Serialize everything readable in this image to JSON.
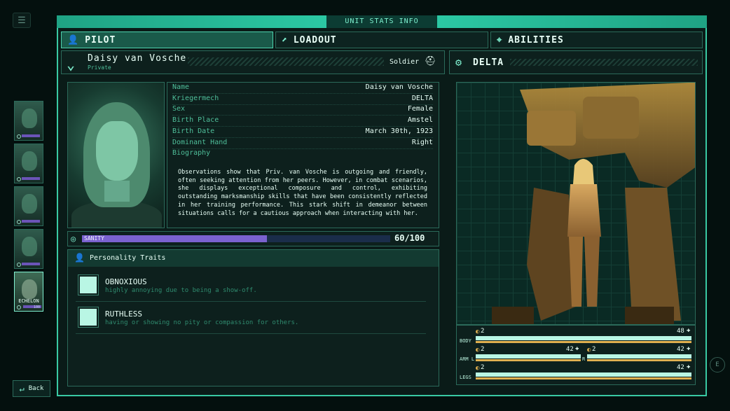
{
  "header": {
    "title": "UNIT STATS INFO",
    "menu_icon": "hamburger-icon"
  },
  "tabs": [
    {
      "label": "PILOT",
      "icon": "person-icon",
      "active": true
    },
    {
      "label": "LOADOUT",
      "icon": "mech-icon",
      "active": false
    },
    {
      "label": "ABILITIES",
      "icon": "crosshair-icon",
      "active": false
    }
  ],
  "roster": [
    {
      "active": false
    },
    {
      "active": false
    },
    {
      "active": false
    },
    {
      "active": false
    },
    {
      "label": "ECHELON",
      "value": "100",
      "active": true
    }
  ],
  "back": {
    "label": "Back"
  },
  "e_hint": "E",
  "pilot": {
    "name": "Daisy van Vosche",
    "rank": "Private",
    "class": "Soldier",
    "details": [
      {
        "key": "Name",
        "value": "Daisy van Vosche"
      },
      {
        "key": "Kriegermech",
        "value": "DELTA"
      },
      {
        "key": "Sex",
        "value": "Female"
      },
      {
        "key": "Birth Place",
        "value": "Amstel"
      },
      {
        "key": "Birth Date",
        "value": "March 30th, 1923"
      },
      {
        "key": "Dominant Hand",
        "value": "Right"
      },
      {
        "key": "Biography",
        "value": ""
      }
    ],
    "biography": "Observations show that Priv. van Vosche is outgoing and friendly, often seeking attention from her peers. However, in combat scenarios, she displays exceptional composure and control, exhibiting outstanding marksmanship skills that have been consistently reflected in her training performance. This stark shift in demeanor between situations calls for a cautious approach when interacting with her.",
    "sanity": {
      "label": "SANITY",
      "value_text": "60/100",
      "value": 60,
      "max": 100
    },
    "traits_title": "Personality Traits",
    "traits": [
      {
        "name": "OBNOXIOUS",
        "desc": "highly annoying due to being a show-off."
      },
      {
        "name": "RUTHLESS",
        "desc": "having or showing no pity or compassion for others."
      }
    ]
  },
  "mech": {
    "name": "DELTA",
    "stats": [
      {
        "label": "BODY",
        "left_val": "2",
        "right_val": "48"
      },
      {
        "label": "ARM L",
        "left_val": "2",
        "right_val": "42",
        "mid_label": "R",
        "left2_val": "2",
        "right2_val": "42"
      },
      {
        "label": "LEGS",
        "left_val": "2",
        "right_val": "42"
      }
    ]
  },
  "colors": {
    "accent": "#39c9a3",
    "sanity": "#7a62cf",
    "stat_bar": "#b9f6e4"
  }
}
